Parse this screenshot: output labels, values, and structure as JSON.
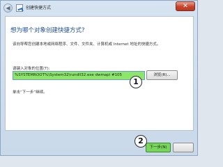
{
  "window": {
    "title": "创建快捷方式",
    "close_glyph": "✕",
    "back_glyph": "◀"
  },
  "main": {
    "heading": "想为哪个对象创建快捷方式?",
    "description": "该向导帮您创建本地或网络程序、文件、文件夹、计算机或 Internet 地址的快捷方式。",
    "location_label": "请键入对象的位置(T):",
    "location_value": "%SYSTEMROOT%\\System32\\rundll32.exe dwmapi #105",
    "browse_label": "浏览(R)...",
    "hint": "单击“下一步”继续。"
  },
  "footer": {
    "next_label": "下一步(N)",
    "cancel_label": ""
  },
  "annotations": {
    "step1": "1",
    "step2": "2"
  },
  "colors": {
    "heading": "#1c4d96",
    "highlight_green": "#8ce66a",
    "close_red": "#c7432b"
  },
  "icons": [
    "back-arrow-icon",
    "wizard-icon",
    "close-icon"
  ]
}
